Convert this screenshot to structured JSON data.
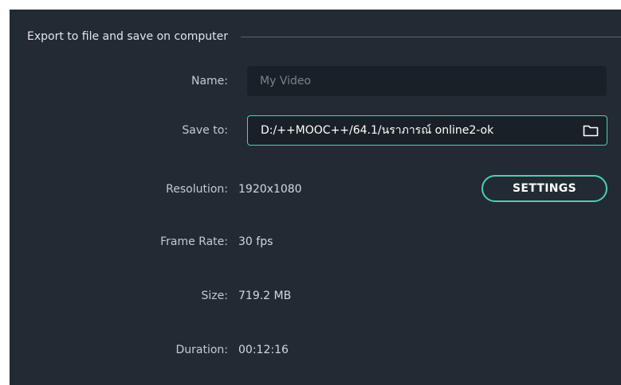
{
  "section": {
    "title": "Export to file and save on computer"
  },
  "fields": {
    "name": {
      "label": "Name:",
      "placeholder": "My Video"
    },
    "save_to": {
      "label": "Save to:",
      "value": "D:/++MOOC++/64.1/นราภารณ์ online2-ok",
      "icon": "folder-icon"
    },
    "resolution": {
      "label": "Resolution:",
      "value": "1920x1080",
      "settings_label": "SETTINGS"
    },
    "frame_rate": {
      "label": "Frame Rate:",
      "value": "30 fps"
    },
    "size": {
      "label": "Size:",
      "value": "719.2 MB"
    },
    "duration": {
      "label": "Duration:",
      "value": "00:12:16"
    }
  },
  "colors": {
    "panel_bg": "#222a33",
    "field_bg": "#1a2027",
    "accent": "#4ecfb5",
    "text": "#d5d9de",
    "placeholder": "#7b828a"
  }
}
